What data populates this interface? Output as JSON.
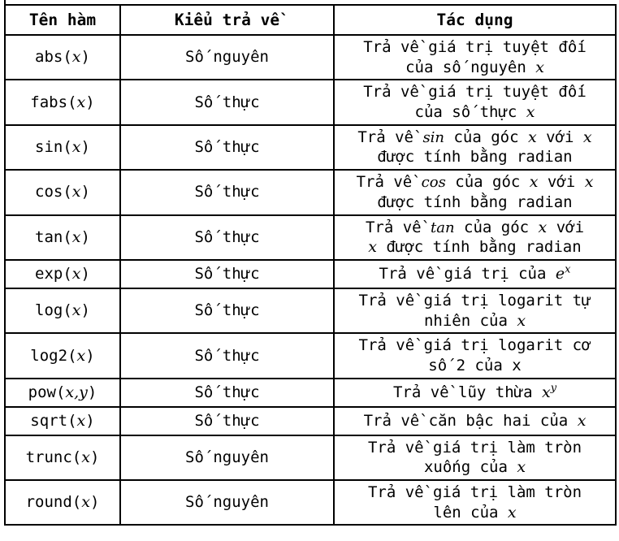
{
  "table": {
    "headers": {
      "name": "Tên hàm",
      "type": "Kiểu trả về",
      "effect": "Tác dụng"
    },
    "types": {
      "integer": "Số nguyên",
      "real": "Số thực"
    },
    "rows": [
      {
        "fn_base": "abs",
        "fn_args": "x",
        "fn_full": "abs(x)",
        "type": "Số nguyên",
        "desc_line1": "Trả về giá trị tuyệt đối",
        "desc_line2_pre": "của số nguyên ",
        "desc_var": "x",
        "desc_full": "Trả về giá trị tuyệt đối của số nguyên x"
      },
      {
        "fn_base": "fabs",
        "fn_args": "x",
        "fn_full": "fabs(x)",
        "type": "Số thực",
        "desc_line1": "Trả về giá trị tuyệt đối",
        "desc_line2_pre": "của số thực ",
        "desc_var": "x",
        "desc_full": "Trả về giá trị tuyệt đối của số thực x"
      },
      {
        "fn_base": "sin",
        "fn_args": "x",
        "fn_full": "sin(x)",
        "type": "Số thực",
        "desc_line1_a": "Trả về ",
        "desc_line1_fn": "sin",
        "desc_line1_b": " của góc ",
        "desc_line1_v1": "x",
        "desc_line1_c": " với ",
        "desc_line1_v2": "x",
        "desc_line2": "được tính bằng radian",
        "desc_full": "Trả về sin của góc x với x được tính bằng radian"
      },
      {
        "fn_base": "cos",
        "fn_args": "x",
        "fn_full": "cos(x)",
        "type": "Số thực",
        "desc_line1_a": "Trả về ",
        "desc_line1_fn": "cos",
        "desc_line1_b": " của góc ",
        "desc_line1_v1": "x",
        "desc_line1_c": " với ",
        "desc_line1_v2": "x",
        "desc_line2": "được tính bằng radian",
        "desc_full": "Trả về cos của góc x với x được tính bằng radian"
      },
      {
        "fn_base": "tan",
        "fn_args": "x",
        "fn_full": "tan(x)",
        "type": "Số thực",
        "desc_line1_a": "Trả về ",
        "desc_line1_fn": "tan",
        "desc_line1_b": " của góc ",
        "desc_line1_v1": "x",
        "desc_line1_c": " với",
        "desc_line2_v": "x",
        "desc_line2": " được tính bằng radian",
        "desc_full": "Trả về tan của góc x với x được tính bằng radian"
      },
      {
        "fn_base": "exp",
        "fn_args": "x",
        "fn_full": "exp(x)",
        "type": "Số thực",
        "desc_pre": "Trả về giá trị của ",
        "desc_base": "e",
        "desc_exp": "x",
        "desc_full": "Trả về giá trị của e^x"
      },
      {
        "fn_base": "log",
        "fn_args": "x",
        "fn_full": "log(x)",
        "type": "Số thực",
        "desc_line1": "Trả về giá trị logarit tự",
        "desc_line2_pre": "nhiên của ",
        "desc_var": "x",
        "desc_full": "Trả về giá trị logarit tự nhiên của x"
      },
      {
        "fn_base": "log2",
        "fn_args": "x",
        "fn_full": "log2(x)",
        "type": "Số thực",
        "desc_line1": "Trả về giá trị logarit cơ",
        "desc_line2": "số 2 của x",
        "desc_full": "Trả về giá trị logarit cơ số 2 của x"
      },
      {
        "fn_base": "pow",
        "fn_args": "x,y",
        "fn_full": "pow(x,y)",
        "type": "Số thực",
        "desc_pre": "Trả về lũy thừa ",
        "desc_base": "x",
        "desc_exp": "y",
        "desc_full": "Trả về lũy thừa x^y"
      },
      {
        "fn_base": "sqrt",
        "fn_args": "x",
        "fn_full": "sqrt(x)",
        "type": "Số thực",
        "desc_line1_pre": "Trả về căn bậc hai của ",
        "desc_var": "x",
        "desc_full": "Trả về căn bậc hai của x"
      },
      {
        "fn_base": "trunc",
        "fn_args": "x",
        "fn_full": "trunc(x)",
        "type": "Số nguyên",
        "desc_line1": "Trả về giá trị làm tròn",
        "desc_line2_pre": "xuống của ",
        "desc_var": "x",
        "desc_full": "Trả về giá trị làm tròn xuống của x"
      },
      {
        "fn_base": "round",
        "fn_args": "x",
        "fn_full": "round(x)",
        "type": "Số nguyên",
        "desc_line1": "Trả về giá trị làm tròn",
        "desc_line2_pre": "lên của ",
        "desc_var": "x",
        "desc_full": "Trả về giá trị làm tròn lên của x"
      }
    ]
  },
  "colors": {
    "border": "#000000",
    "text": "#000000",
    "background": "#ffffff"
  }
}
